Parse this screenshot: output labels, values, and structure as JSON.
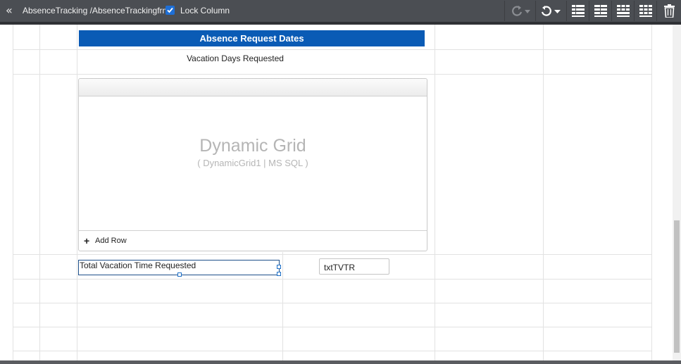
{
  "toolbar": {
    "path": "AbsenceTracking /AbsenceTrackingfrm",
    "lock_checked": true,
    "lock_label": "Lock Column",
    "icons": [
      "double-chevron-left-icon",
      "redo-icon",
      "undo-icon",
      "layout-grid-icon",
      "trash-icon"
    ]
  },
  "form": {
    "header": "Absence Request Dates",
    "vacation_label": "Vacation Days Requested",
    "grid_title": "Dynamic Grid",
    "grid_subtitle": "( DynamicGrid1 | MS SQL )",
    "add_row_label": "Add Row",
    "total_label": "Total Vacation Time Requested",
    "txt_value": "txtTVTR"
  },
  "colors": {
    "header_bg": "#0a5bb5",
    "toolbar_bg": "#4b4e53",
    "selection": "#1d4f8a"
  }
}
